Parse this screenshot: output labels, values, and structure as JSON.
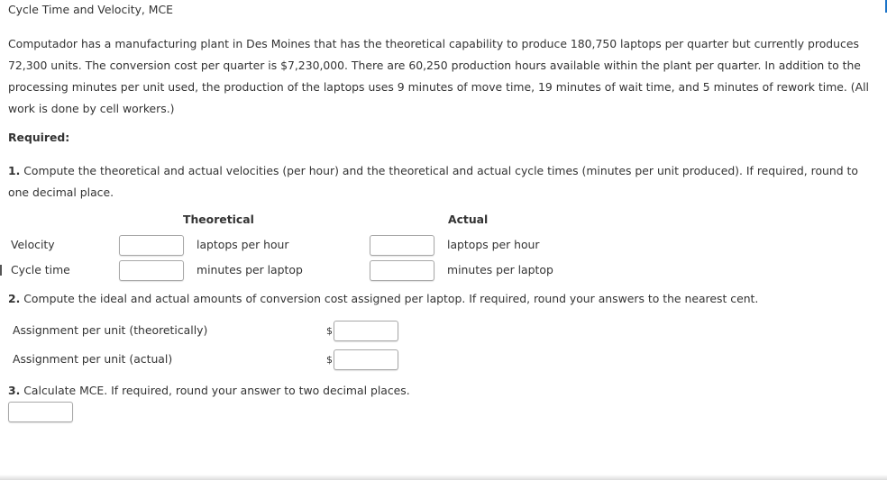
{
  "problem": {
    "title": "Cycle Time and Velocity, MCE",
    "intro": "Computador has a manufacturing plant in Des Moines that has the theoretical capability to produce 180,750 laptops per quarter but currently produces 72,300 units. The conversion cost per quarter is $7,230,000. There are 60,250 production hours available within the plant per quarter. In addition to the processing minutes per unit used, the production of the laptops uses 9 minutes of move time, 19 minutes of wait time, and 5 minutes of rework time. (All work is done by cell workers.)",
    "required_label": "Required:"
  },
  "q1": {
    "number": "1.",
    "text": " Compute the theoretical and actual velocities (per hour) and the theoretical and actual cycle times (minutes per unit produced). If required, round to one decimal place.",
    "col_theoretical": "Theoretical",
    "col_actual": "Actual",
    "rows": [
      {
        "label": "Velocity",
        "unit": "laptops per hour",
        "theoretical_value": "",
        "actual_value": ""
      },
      {
        "label": "Cycle time",
        "unit": "minutes per laptop",
        "theoretical_value": "",
        "actual_value": ""
      }
    ]
  },
  "q2": {
    "number": "2.",
    "text": " Compute the ideal and actual amounts of conversion cost assigned per laptop. If required, round your answers to the nearest cent.",
    "currency_symbol": "$",
    "rows": [
      {
        "label": "Assignment per unit (theoretically)",
        "value": ""
      },
      {
        "label": "Assignment per unit (actual)",
        "value": ""
      }
    ]
  },
  "q3": {
    "number": "3.",
    "text": " Calculate MCE. If required, round your answer to two decimal places.",
    "value": ""
  }
}
